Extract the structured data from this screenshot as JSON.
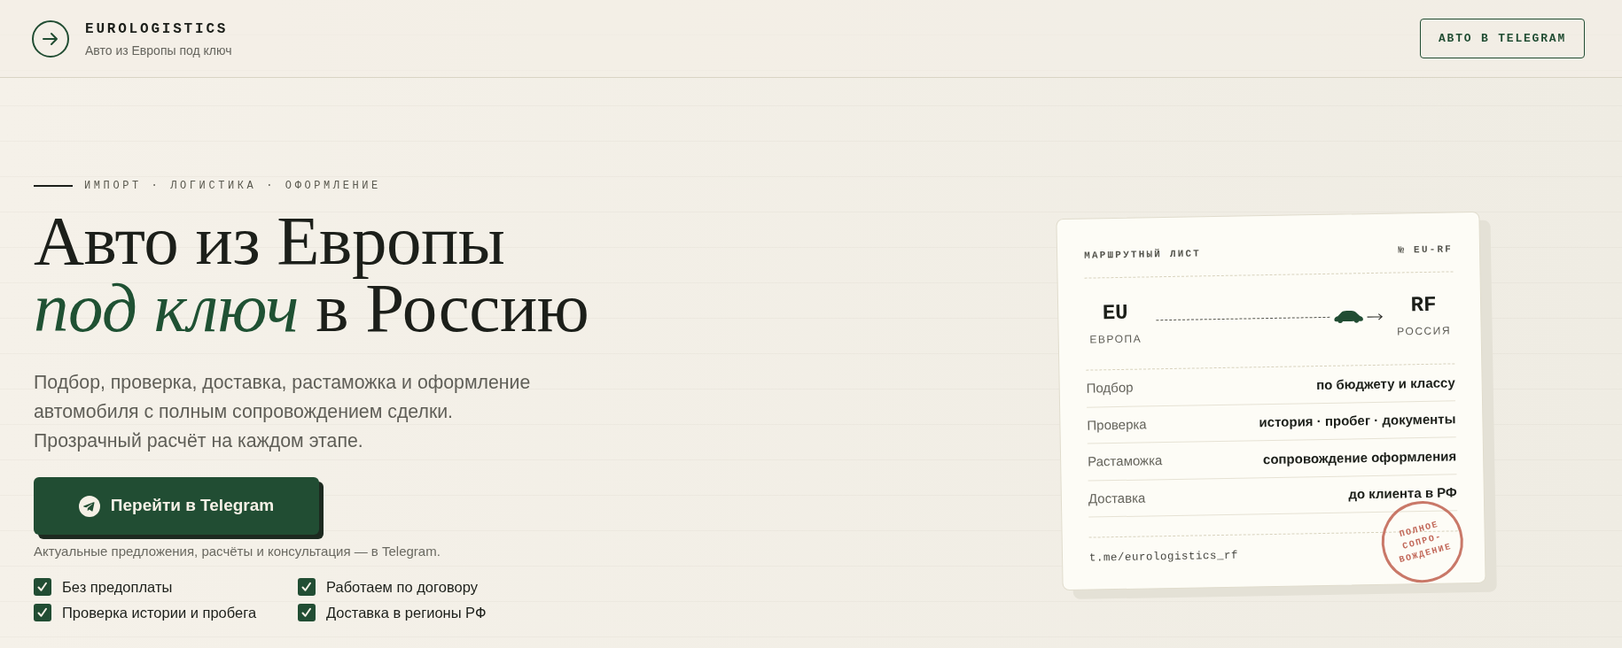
{
  "header": {
    "brand": "EUROLOGISTICS",
    "tagline": "Авто из Европы под ключ",
    "cta": "АВТО В TELEGRAM"
  },
  "hero": {
    "eyebrow": "ИМПОРТ · ЛОГИСТИКА · ОФОРМЛЕНИЕ",
    "headline": [
      "Авто из Европы",
      "*под ключ* в Россию"
    ],
    "lead": [
      "Подбор, проверка, доставка, растаможка и оформление автомобиля с полным сопровождением сделки.",
      "Прозрачный расчёт на каждом этапе."
    ],
    "button": "Перейти в Telegram",
    "caption": "Актуальные предложения, расчёты и консультация — в Telegram.",
    "benefits": [
      {
        "label": "Без предоплаты",
        "checked": true
      },
      {
        "label": "Работаем по договору",
        "checked": true
      },
      {
        "label": "Проверка истории и пробега",
        "checked": true
      },
      {
        "label": "Доставка в регионы РФ",
        "checked": true
      }
    ]
  },
  "route_card": {
    "title": "МАРШРУТНЫЙ ЛИСТ",
    "number": "№ EU-RF",
    "from": {
      "code": "EU",
      "name": "ЕВРОПА"
    },
    "to": {
      "code": "RF",
      "name": "РОССИЯ"
    },
    "rows": [
      {
        "label": "Подбор",
        "value": "по бюджету и классу"
      },
      {
        "label": "Проверка",
        "value": "история · пробег · документы"
      },
      {
        "label": "Растаможка",
        "value": "сопровождение оформления"
      },
      {
        "label": "Доставка",
        "value": "до клиента в РФ"
      }
    ],
    "link": "t.me/eurologistics_rf",
    "stamp": [
      "ПОЛНОЕ",
      "СОПРО-",
      "ВОЖДЕНИЕ"
    ]
  }
}
